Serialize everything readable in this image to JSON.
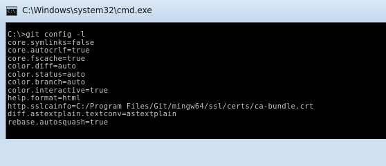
{
  "window": {
    "title": "C:\\Windows\\system32\\cmd.exe",
    "icon": "cmd-icon"
  },
  "console": {
    "lines": [
      "C:\\>git config -l",
      "core.symlinks=false",
      "core.autocrlf=true",
      "core.fscache=true",
      "color.diff=auto",
      "color.status=auto",
      "color.branch=auto",
      "color.interactive=true",
      "help.format=html",
      "http.sslcainfo=C:/Program Files/Git/mingw64/ssl/certs/ca-bundle.crt",
      "diff.astextplain.textconv=astextplain",
      "rebase.autosquash=true"
    ],
    "background": "#000000",
    "foreground": "#c0c0c0"
  }
}
